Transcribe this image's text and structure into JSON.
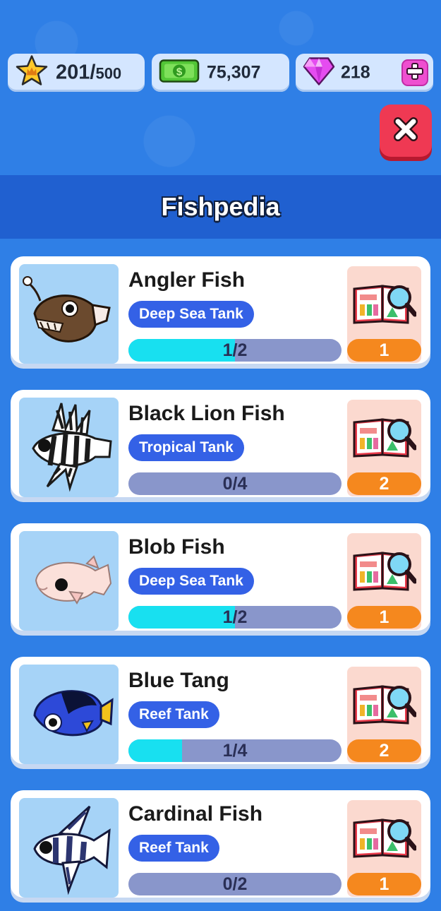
{
  "header": {
    "stars": {
      "value": "201/",
      "max": "500",
      "icon": "star-crown-icon"
    },
    "cash": {
      "value": "75,307",
      "icon": "cash-icon"
    },
    "gems": {
      "value": "218",
      "icon": "gem-icon",
      "add_icon": "plus-icon"
    },
    "close_icon": "close-icon"
  },
  "title": "Fishpedia",
  "colors": {
    "background": "#2f7fe6",
    "badge": "#3461e6",
    "progress_fill": "#18e0f0",
    "progress_track": "#8996cb",
    "count": "#f5881e",
    "close": "#ef3953"
  },
  "fish": [
    {
      "name": "Angler Fish",
      "tank": "Deep Sea Tank",
      "progress": "1/2",
      "fraction": 0.5,
      "count": "1",
      "icon": "angler-fish-icon"
    },
    {
      "name": "Black Lion Fish",
      "tank": "Tropical Tank",
      "progress": "0/4",
      "fraction": 0,
      "count": "2",
      "icon": "lion-fish-icon"
    },
    {
      "name": "Blob Fish",
      "tank": "Deep Sea Tank",
      "progress": "1/2",
      "fraction": 0.5,
      "count": "1",
      "icon": "blob-fish-icon"
    },
    {
      "name": "Blue Tang",
      "tank": "Reef Tank",
      "progress": "1/4",
      "fraction": 0.25,
      "count": "2",
      "icon": "blue-tang-icon"
    },
    {
      "name": "Cardinal Fish",
      "tank": "Reef Tank",
      "progress": "0/2",
      "fraction": 0,
      "count": "1",
      "icon": "cardinal-fish-icon"
    }
  ]
}
